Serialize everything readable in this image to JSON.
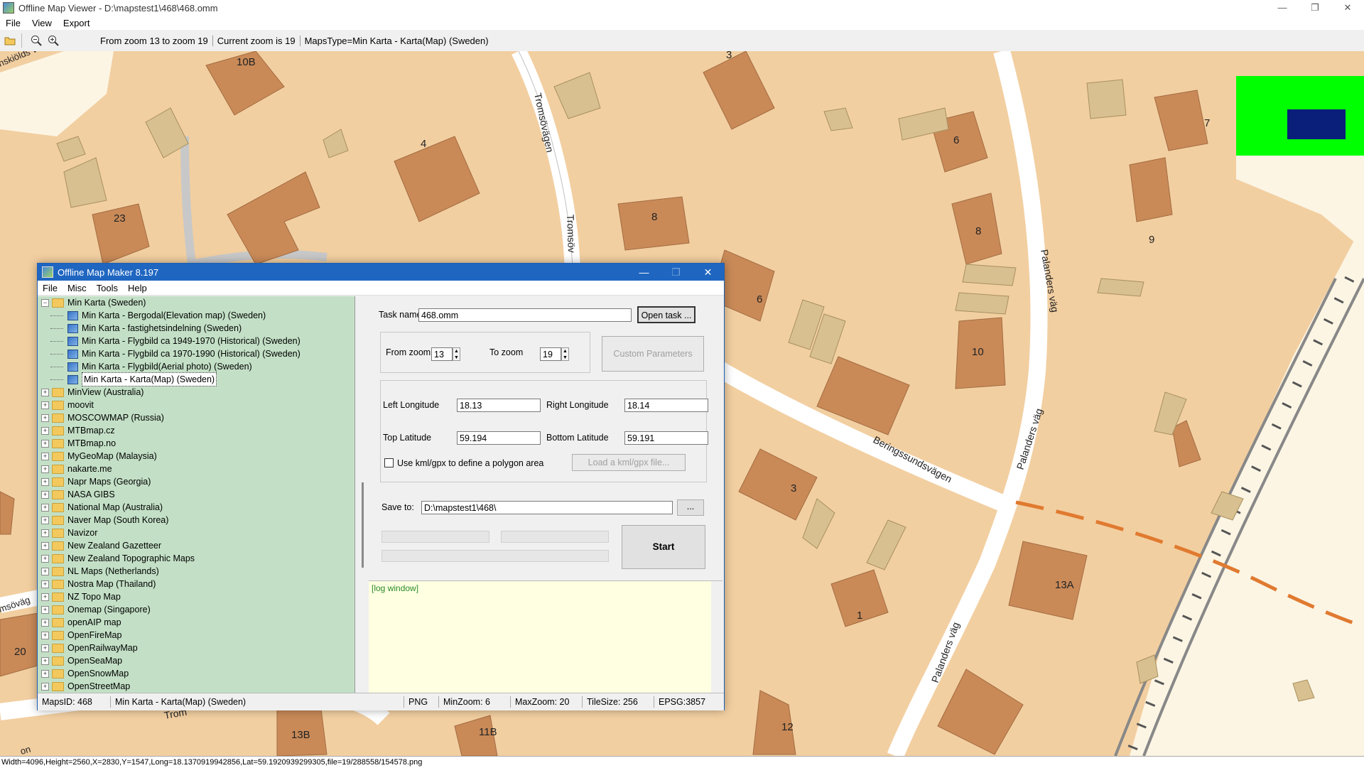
{
  "window": {
    "title": "Offline Map Viewer - D:\\mapstest1\\468\\468.omm",
    "controls": [
      "—",
      "❐",
      "✕"
    ]
  },
  "menu": [
    "File",
    "View",
    "Export"
  ],
  "toolbar": {
    "zoom_range": "From zoom 13 to zoom 19",
    "current_zoom": "Current zoom is 19",
    "maps_type": "MapsType=Min Karta - Karta(Map) (Sweden)"
  },
  "map": {
    "streets": [
      "Tromsövägen",
      "Tromsöv",
      "Palanders väg",
      "Palanders väg",
      "Beringssundsvägen",
      "Palanders väg",
      "nskiölds väg",
      "msöväg",
      "Trom"
    ],
    "house_numbers": [
      "10B",
      "4",
      "23",
      "3",
      "8",
      "6",
      "8",
      "9",
      "7",
      "10",
      "6",
      "3",
      "1",
      "13A",
      "12",
      "13B",
      "11B",
      "20",
      "on"
    ]
  },
  "status": {
    "text": "Width=4096,Height=2560,X=2830,Y=1547,Long=18.1370919942856,Lat=59.1920939299305,file=19/288558/154578.png"
  },
  "dialog": {
    "title": "Offline Map Maker 8.197",
    "menu": [
      "File",
      "Misc",
      "Tools",
      "Help"
    ],
    "tree": {
      "expanded_folder": "Min Karta (Sweden)",
      "children": [
        "Min Karta - Bergodal(Elevation map) (Sweden)",
        "Min Karta - fastighetsindelning (Sweden)",
        "Min Karta - Flygbild ca 1949-1970 (Historical) (Sweden)",
        "Min Karta - Flygbild ca 1970-1990 (Historical) (Sweden)",
        "Min Karta - Flygbild(Aerial photo) (Sweden)",
        "Min Karta - Karta(Map) (Sweden)"
      ],
      "folders": [
        "MinView (Australia)",
        "moovit",
        "MOSCOWMAP (Russia)",
        "MTBmap.cz",
        "MTBmap.no",
        "MyGeoMap (Malaysia)",
        "nakarte.me",
        "Napr Maps (Georgia)",
        "NASA GIBS",
        "National Map (Australia)",
        "Naver Map (South Korea)",
        "Navizor",
        "New Zealand Gazetteer",
        "New Zealand Topographic Maps",
        "NL Maps (Netherlands)",
        "Nostra Map (Thailand)",
        "NZ Topo Map",
        "Onemap (Singapore)",
        "openAIP map",
        "OpenFireMap",
        "OpenRailwayMap",
        "OpenSeaMap",
        "OpenSnowMap",
        "OpenStreetMap"
      ]
    },
    "form": {
      "task_label": "Task name",
      "task_value": "468.omm",
      "open_task": "Open task ...",
      "from_zoom_label": "From zoom",
      "from_zoom": "13",
      "to_zoom_label": "To zoom",
      "to_zoom": "19",
      "custom_params": "Custom Parameters",
      "left_lon_label": "Left Longitude",
      "left_lon": "18.13",
      "right_lon_label": "Right Longitude",
      "right_lon": "18.14",
      "top_lat_label": "Top Latitude",
      "top_lat": "59.194",
      "bottom_lat_label": "Bottom Latitude",
      "bottom_lat": "59.191",
      "kml_label": "Use kml/gpx to define a polygon area",
      "load_kml": "Load a kml/gpx file...",
      "save_label": "Save to:",
      "save_value": "D:\\mapstest1\\468\\",
      "browse": "...",
      "start": "Start"
    },
    "log": "[log window]",
    "statusbar": [
      "MapsID: 468",
      "Min Karta - Karta(Map) (Sweden)",
      "PNG",
      "MinZoom: 6",
      "MaxZoom: 20",
      "TileSize: 256",
      "EPSG:3857"
    ]
  },
  "colors": {
    "map_bg": "#f2cfa1",
    "building": "#c98a58",
    "road": "#ffffff",
    "tree_bg": "#c3e0c6",
    "title_blue": "#1f66c1",
    "log_bg": "#ffffe1"
  }
}
